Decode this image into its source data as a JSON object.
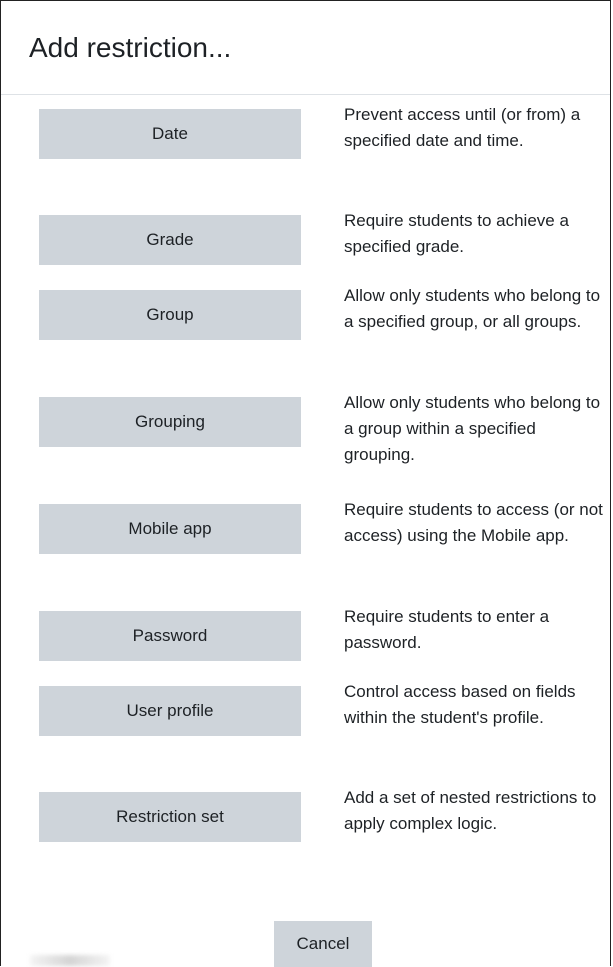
{
  "dialog": {
    "title": "Add restriction..."
  },
  "options": [
    {
      "label": "Date",
      "description": "Prevent access until (or from) a specified date and time."
    },
    {
      "label": "Grade",
      "description": "Require students to achieve a specified grade."
    },
    {
      "label": "Group",
      "description": "Allow only students who belong to a specified group, or all groups."
    },
    {
      "label": "Grouping",
      "description": "Allow only students who belong to a group within a specified grouping."
    },
    {
      "label": "Mobile app",
      "description": "Require students to access (or not access) using the Mobile app."
    },
    {
      "label": "Password",
      "description": "Require students to enter a password."
    },
    {
      "label": "User profile",
      "description": "Control access based on fields within the student's profile."
    },
    {
      "label": "Restriction set",
      "description": "Add a set of nested restrictions to apply complex logic."
    }
  ],
  "footer": {
    "cancel_label": "Cancel"
  },
  "colors": {
    "button_bg": "#ced4da",
    "text": "#1d2125"
  }
}
